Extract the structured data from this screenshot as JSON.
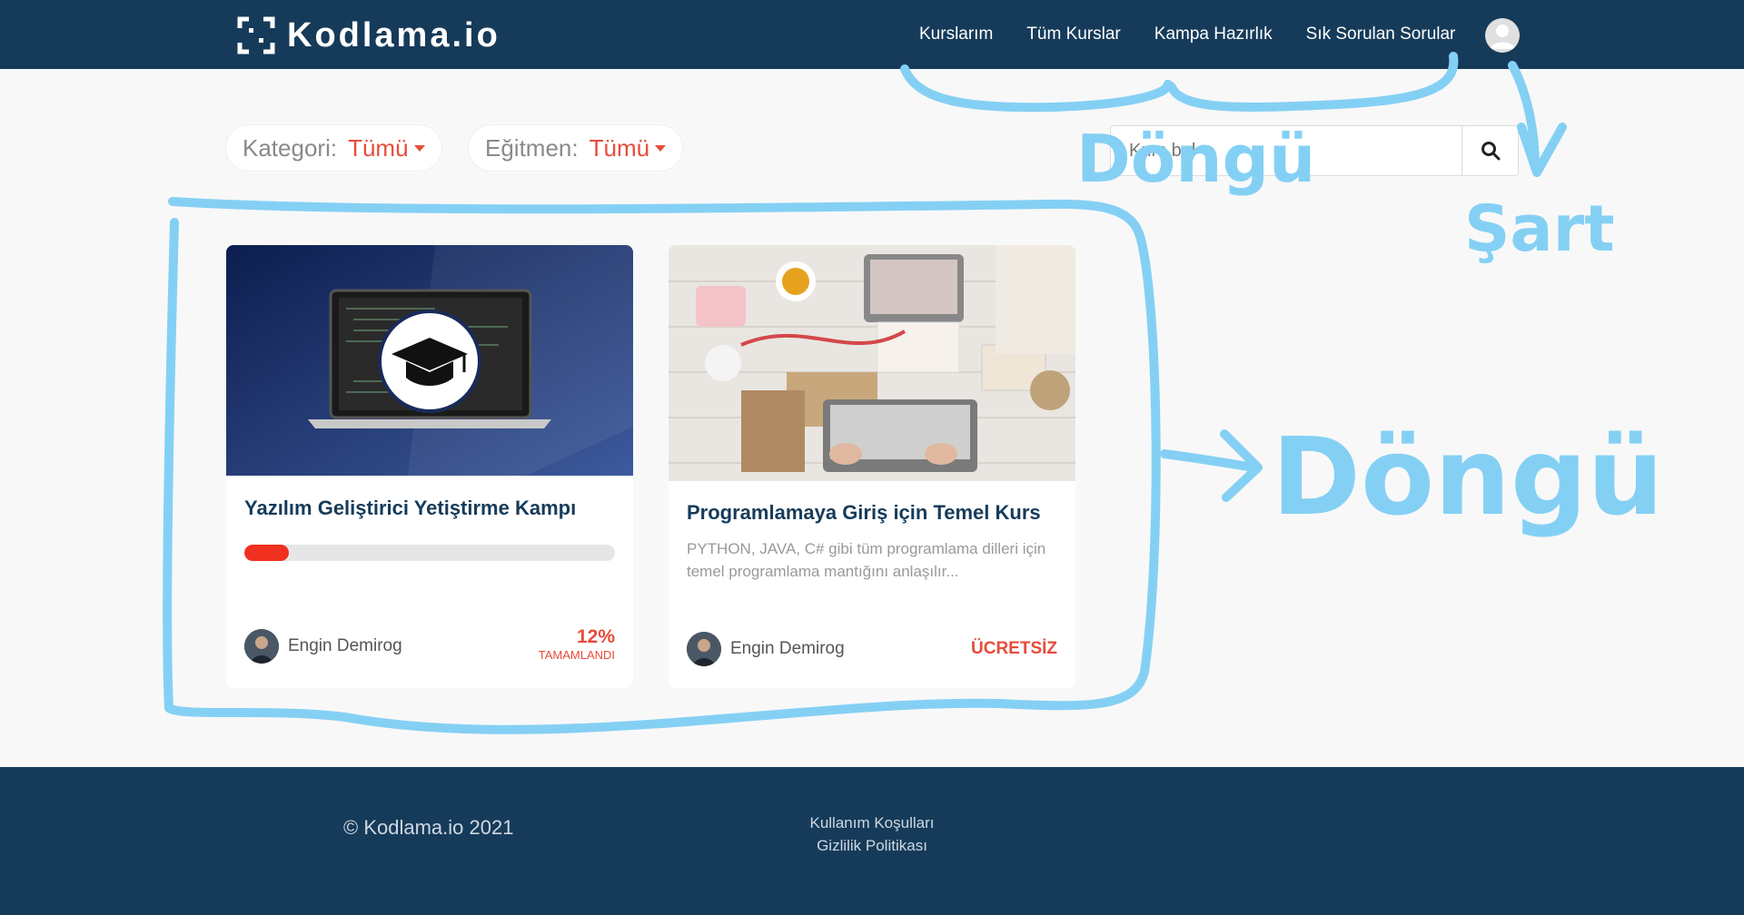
{
  "header": {
    "brand": "Kodlama.io",
    "nav": [
      "Kurslarım",
      "Tüm Kurslar",
      "Kampa Hazırlık",
      "Sık Sorulan Sorular"
    ]
  },
  "filters": {
    "category_label": "Kategori:",
    "category_value": "Tümü",
    "instructor_label": "Eğitmen:",
    "instructor_value": "Tümü"
  },
  "search": {
    "placeholder": "Kurs bul"
  },
  "courses": [
    {
      "title": "Yazılım Geliştirici Yetiştirme Kampı",
      "progress_percent": 12,
      "author": "Engin Demirog",
      "status_value": "12%",
      "status_label": "TAMAMLANDI"
    },
    {
      "title": "Programlamaya Giriş için Temel Kurs",
      "description": "PYTHON, JAVA, C# gibi tüm programlama dilleri için temel programlama mantığını anlaşılır...",
      "author": "Engin Demirog",
      "status_value": "ÜCRETSİZ"
    }
  ],
  "footer": {
    "copyright": "© Kodlama.io 2021",
    "links": [
      "Kullanım Koşulları",
      "Gizlilik Politikası"
    ]
  },
  "annotations": {
    "top_loop": "Döngü",
    "condition": "Şart",
    "cards_loop": "Döngü"
  },
  "colors": {
    "header_bg": "#163b5a",
    "accent": "#e74c3c",
    "annotation": "#84d0f4"
  }
}
